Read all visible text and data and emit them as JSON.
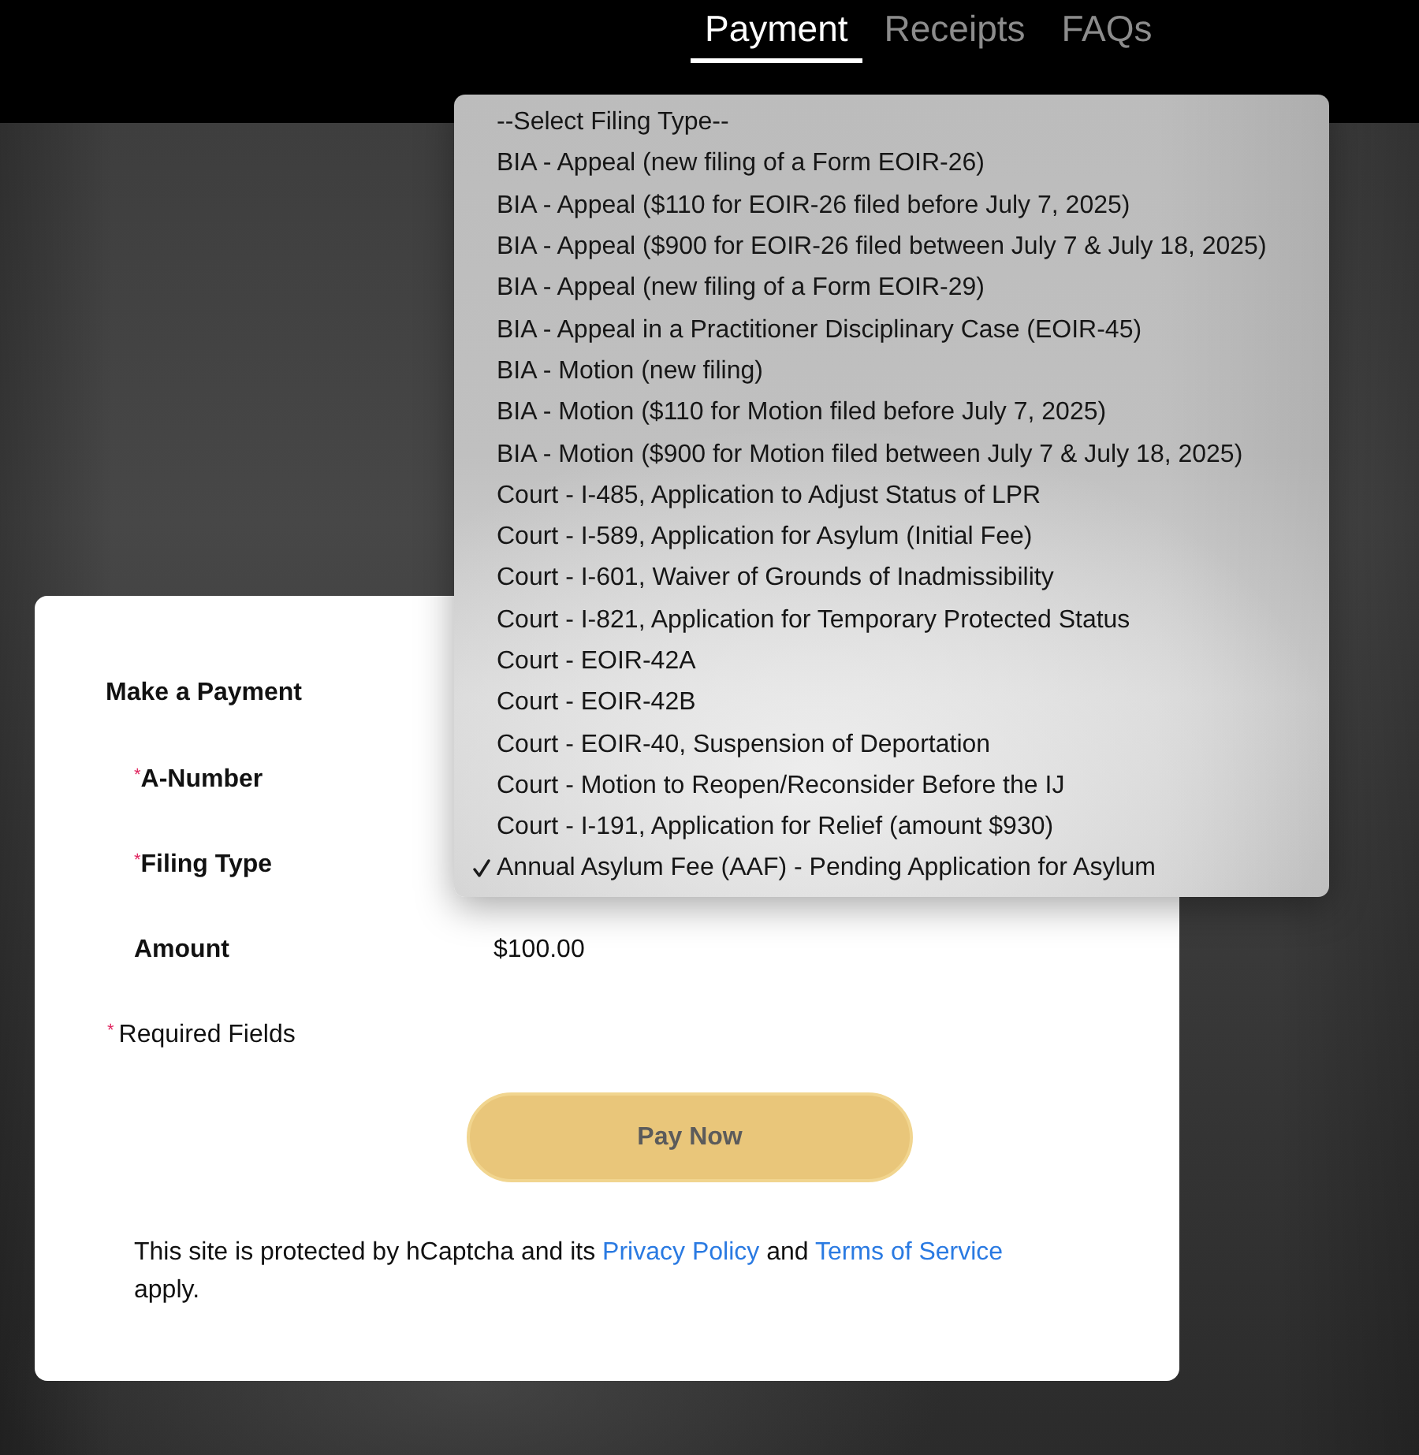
{
  "tabs": [
    {
      "label": "Payment",
      "selected": true
    },
    {
      "label": "Receipts",
      "selected": false
    },
    {
      "label": "FAQs",
      "selected": false
    }
  ],
  "payment_form": {
    "title": "Make a Payment",
    "fields": [
      {
        "label": "A-Number",
        "required_mark": "*"
      },
      {
        "label": "Filing Type",
        "required_mark": "*"
      },
      {
        "label": "Amount",
        "value": "$100.00"
      }
    ],
    "required_note": {
      "mark": "*",
      "text": "Required Fields"
    },
    "submit_button": "Pay Now",
    "captcha_notice": [
      {
        "kind": "text",
        "text": "This site is protected by hCaptcha and its"
      },
      {
        "kind": "link",
        "text": "Privacy Policy"
      },
      {
        "kind": "text",
        "text": "and"
      },
      {
        "kind": "link",
        "text": "Terms of Service"
      },
      {
        "kind": "text",
        "text": "apply."
      }
    ]
  },
  "filing_type_menu": {
    "items": [
      {
        "label": "--Select Filing Type--",
        "selected": false
      },
      {
        "label": "BIA - Appeal (new filing of a Form EOIR-26)",
        "selected": false
      },
      {
        "label": "BIA - Appeal ($110 for EOIR-26 filed before July 7, 2025)",
        "selected": false
      },
      {
        "label": "BIA - Appeal ($900 for EOIR-26 filed between July 7 & July 18, 2025)",
        "selected": false
      },
      {
        "label": "BIA - Appeal (new filing of a Form EOIR-29)",
        "selected": false
      },
      {
        "label": "BIA - Appeal in a Practitioner Disciplinary Case (EOIR-45)",
        "selected": false
      },
      {
        "label": "BIA - Motion (new filing)",
        "selected": false
      },
      {
        "label": "BIA - Motion ($110 for Motion filed before July 7, 2025)",
        "selected": false
      },
      {
        "label": "BIA - Motion ($900 for Motion filed between July 7 & July 18, 2025)",
        "selected": false
      },
      {
        "label": "Court - I-485, Application to Adjust Status of LPR",
        "selected": false
      },
      {
        "label": "Court - I-589, Application for Asylum (Initial Fee)",
        "selected": false
      },
      {
        "label": "Court - I-601, Waiver of Grounds of Inadmissibility",
        "selected": false
      },
      {
        "label": "Court - I-821, Application for Temporary Protected Status",
        "selected": false
      },
      {
        "label": "Court - EOIR-42A",
        "selected": false
      },
      {
        "label": "Court - EOIR-42B",
        "selected": false
      },
      {
        "label": "Court - EOIR-40, Suspension of Deportation",
        "selected": false
      },
      {
        "label": "Court - Motion to Reopen/Reconsider Before the IJ",
        "selected": false
      },
      {
        "label": "Court - I-191, Application for Relief (amount $930)",
        "selected": false
      },
      {
        "label": "Annual Asylum Fee (AAF) - Pending Application for Asylum",
        "selected": true
      }
    ]
  }
}
